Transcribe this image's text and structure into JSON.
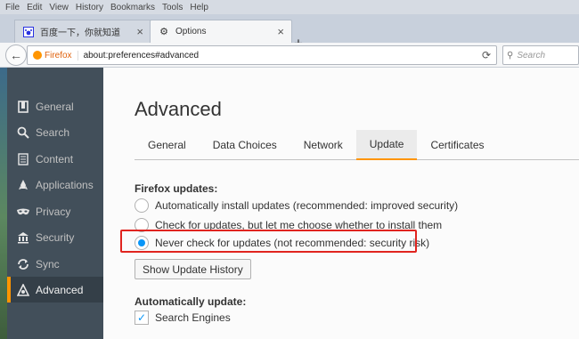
{
  "menu": [
    "File",
    "Edit",
    "View",
    "History",
    "Bookmarks",
    "Tools",
    "Help"
  ],
  "tabs": [
    {
      "title": "百度一下，你就知道",
      "close": "×"
    },
    {
      "title": "Options",
      "close": "×"
    }
  ],
  "new_tab": "+",
  "nav": {
    "identity": "Firefox",
    "url": "about:preferences#advanced",
    "search_placeholder": "Search"
  },
  "sidebar": {
    "items": [
      {
        "label": "General",
        "icon": "general-icon"
      },
      {
        "label": "Search",
        "icon": "search-icon"
      },
      {
        "label": "Content",
        "icon": "content-icon"
      },
      {
        "label": "Applications",
        "icon": "applications-icon"
      },
      {
        "label": "Privacy",
        "icon": "privacy-mask-icon"
      },
      {
        "label": "Security",
        "icon": "security-icon"
      },
      {
        "label": "Sync",
        "icon": "sync-icon"
      },
      {
        "label": "Advanced",
        "icon": "advanced-icon"
      }
    ],
    "selected": "Advanced"
  },
  "main": {
    "title": "Advanced",
    "tabs": [
      "General",
      "Data Choices",
      "Network",
      "Update",
      "Certificates"
    ],
    "selected_tab": "Update",
    "updates": {
      "label": "Firefox updates:",
      "options": [
        "Automatically install updates (recommended: improved security)",
        "Check for updates, but let me choose whether to install them",
        "Never check for updates (not recommended: security risk)"
      ],
      "selected_index": 2
    },
    "history_button": "Show Update History",
    "auto_update": {
      "label": "Automatically update:",
      "search_engines": "Search Engines",
      "search_engines_checked": true
    }
  },
  "colors": {
    "accent": "#ff9500",
    "highlight_box": "#e0241f",
    "radio_selected": "#0996f8"
  }
}
